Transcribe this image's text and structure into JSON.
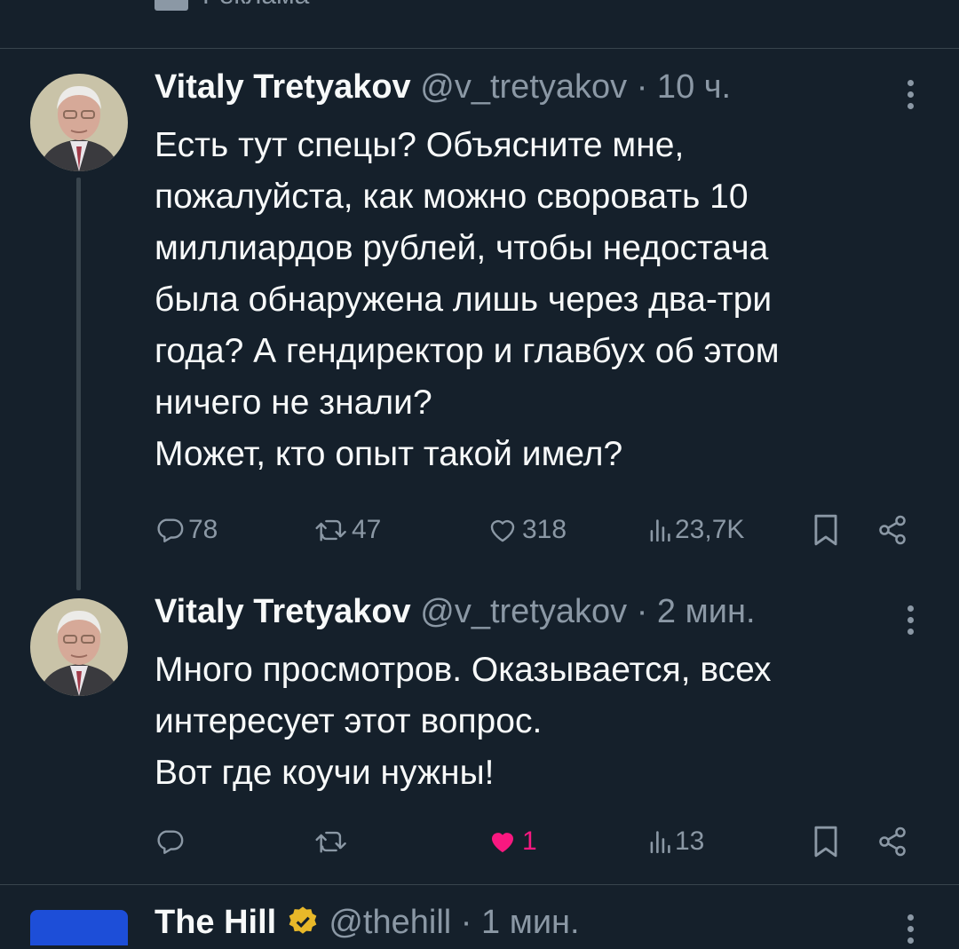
{
  "top_ad": {
    "label": "Реклама"
  },
  "tweets": [
    {
      "name": "Vitaly Tretyakov",
      "handle": "@v_tretyakov",
      "time": "· 10 ч.",
      "lines": [
        "Есть тут спецы? Объясните мне,",
        "пожалуйста, как можно своровать 10",
        "миллиардов рублей, чтобы недостача",
        "была обнаружена лишь через два-три",
        "года? А гендиректор и главбух об этом",
        "ничего не знали?",
        "Может, кто опыт такой имел?"
      ],
      "replies": "78",
      "retweets": "47",
      "likes": "318",
      "views": "23,7K"
    },
    {
      "name": "Vitaly Tretyakov",
      "handle": "@v_tretyakov",
      "time": "· 2 мин.",
      "lines": [
        "Много просмотров. Оказывается, всех",
        "интересует этот вопрос.",
        "Вот где коучи нужны!"
      ],
      "replies": "",
      "retweets": "",
      "likes": "1",
      "views": "13"
    }
  ],
  "next_tweet": {
    "name": "The Hill",
    "handle": "@thehill",
    "time": "· 1 мин."
  },
  "colors": {
    "background": "#15202b",
    "text": "#f7f9f9",
    "muted": "#8b98a5",
    "like_active": "#f91880",
    "verified": "#e8b829"
  }
}
